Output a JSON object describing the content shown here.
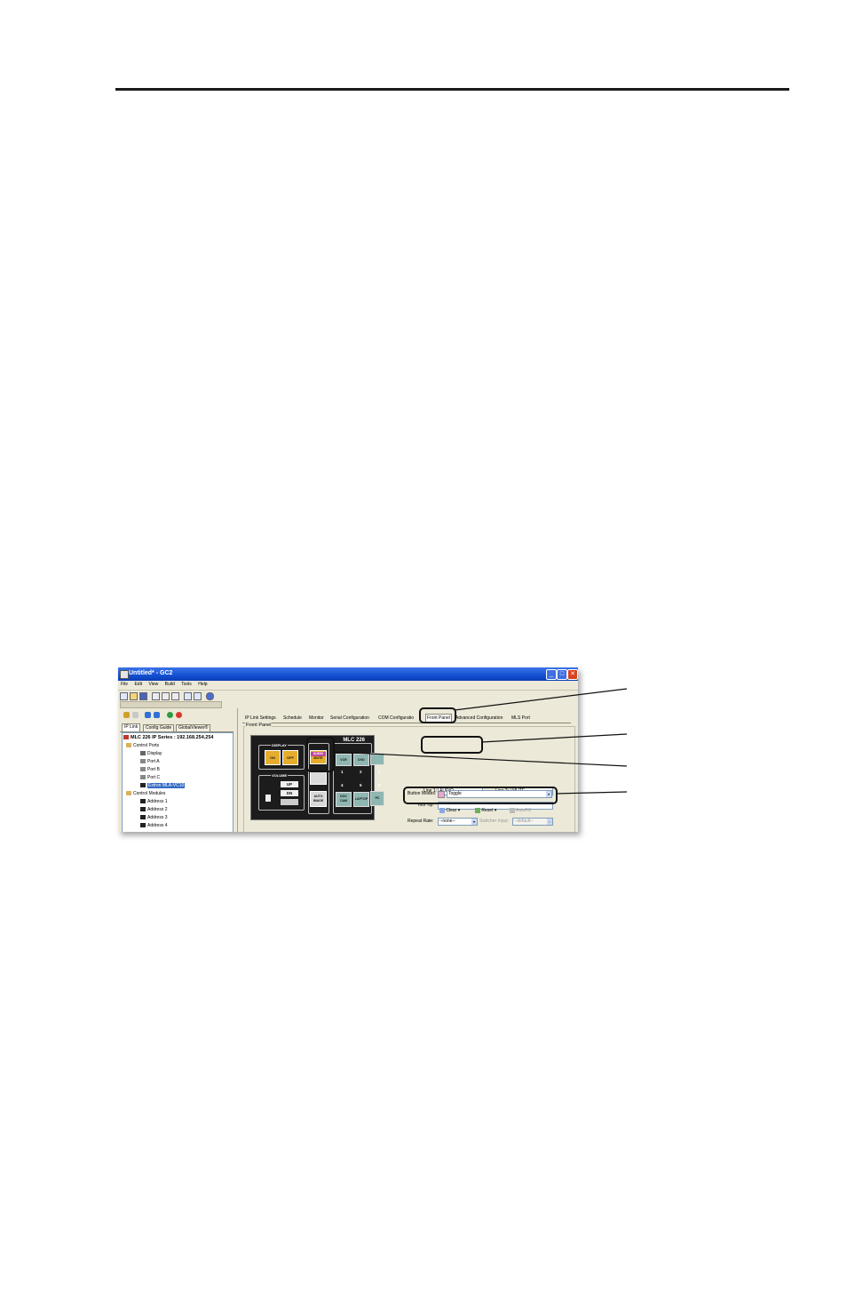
{
  "window": {
    "title": "Untitled* - GC2",
    "controls": {
      "minimize": "_",
      "maximize": "□",
      "close": "✕"
    }
  },
  "menu": [
    "File",
    "Edit",
    "View",
    "Build",
    "Tools",
    "Help"
  ],
  "left_tabs": [
    "IP Link",
    "Config Guide",
    "GlobalViewer®"
  ],
  "tree": {
    "root": "MLC 226 IP Series : 192.168.254.254",
    "control_ports": "Control Ports",
    "display": "Display",
    "port_a": "Port A",
    "port_b": "Port B",
    "port_c": "Port C",
    "extron": "Extron MLA-VC10",
    "control_modules": "Control Modules",
    "addresses": [
      "Address 1",
      "Address 2",
      "Address 3",
      "Address 4"
    ]
  },
  "right_tabs": [
    "IP Link Settings",
    "Schedule",
    "Monitor",
    "Serial Configuration",
    "COM Configuratio",
    "Front Panel",
    "Advanced Configuration",
    "MLS Port"
  ],
  "front_panel": {
    "group_label": "Front Panel",
    "model": "MLC 226",
    "display_label": "DISPLAY",
    "on": "ON",
    "off": "OFF",
    "audio_mute_1": "AUDIO",
    "audio_mute_2": "MUTE",
    "volume_label": "VOLUME",
    "up": "UP",
    "dn": "DN",
    "auto_image_1": "AUTO",
    "auto_image_2": "IMAGE",
    "btn_top_1": "VCR",
    "btn_top_2": "DVD",
    "nums": [
      "1",
      "2",
      "3",
      "4",
      "5",
      "6"
    ],
    "doc_cam_1": "DOC",
    "doc_cam_2": "CAM",
    "laptop": "LAPTOP",
    "pc": "PC"
  },
  "fields": {
    "line1_label": "Line 1:",
    "line1_value": "AUDIO",
    "line2_label": "Line 2:",
    "line2_value": "MUTE",
    "tooltip_label": "Tool Tip:",
    "repeat_label": "Repeat Rate:",
    "repeat_value": "--none--",
    "switcher_label": "Switcher Input:",
    "switcher_value": "--default--",
    "mode_label": "Button Modes:",
    "mode_value": "Toggle",
    "clear": "Clear",
    "reset": "Reset",
    "autofill": "AutoFill"
  },
  "colors": {
    "titlebar": "#1450d2",
    "device_bg": "#1c1c1c",
    "yellow_button": "#e6ad2c",
    "teal_button": "#8fb7b2"
  }
}
